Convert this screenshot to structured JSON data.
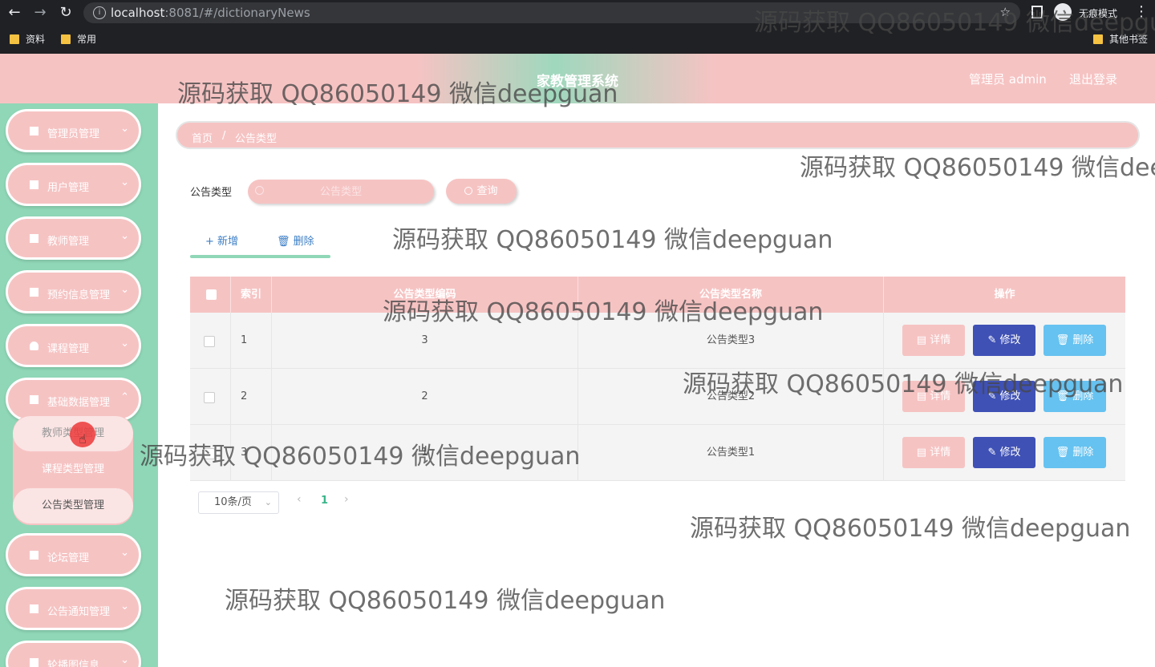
{
  "browser": {
    "url_host": "localhost",
    "url_rest": ":8081/#/dictionaryNews",
    "incognito_label": "无痕模式",
    "bookmarks": [
      "资料",
      "常用"
    ],
    "other_bookmarks": "其他书签"
  },
  "header": {
    "title": "家教管理系统",
    "admin": "管理员 admin",
    "logout": "退出登录"
  },
  "sidebar": {
    "items": [
      {
        "label": "管理员管理"
      },
      {
        "label": "用户管理"
      },
      {
        "label": "教师管理"
      },
      {
        "label": "预约信息管理"
      },
      {
        "label": "课程管理"
      },
      {
        "label": "基础数据管理"
      },
      {
        "label": "论坛管理"
      },
      {
        "label": "公告通知管理"
      },
      {
        "label": "轮播图信息"
      }
    ],
    "submenu": [
      "教师类型管理",
      "课程类型管理",
      "公告类型管理"
    ]
  },
  "breadcrumb": {
    "home": "首页",
    "separator": "/",
    "current": "公告类型"
  },
  "search": {
    "label": "公告类型",
    "placeholder": "公告类型",
    "button": "查询"
  },
  "actions": {
    "add": "+ 新增",
    "delete": "删除"
  },
  "table": {
    "headers": [
      "索引",
      "公告类型编码",
      "公告类型名称",
      "操作"
    ],
    "rows": [
      {
        "index": "1",
        "code": "3",
        "name": "公告类型3"
      },
      {
        "index": "2",
        "code": "2",
        "name": "公告类型2"
      },
      {
        "index": "3",
        "code": "1",
        "name": "公告类型1"
      }
    ],
    "ops": {
      "detail": "详情",
      "edit": "修改",
      "delete": "删除"
    }
  },
  "pagination": {
    "page_size": "10条/页",
    "current_page": "1"
  },
  "watermark": "源码获取 QQ86050149 微信deepguan",
  "colors": {
    "pink": "#f6c3c3",
    "mint": "#8fd7b7",
    "indigo": "#3f51b5",
    "sky": "#66c2f0"
  }
}
